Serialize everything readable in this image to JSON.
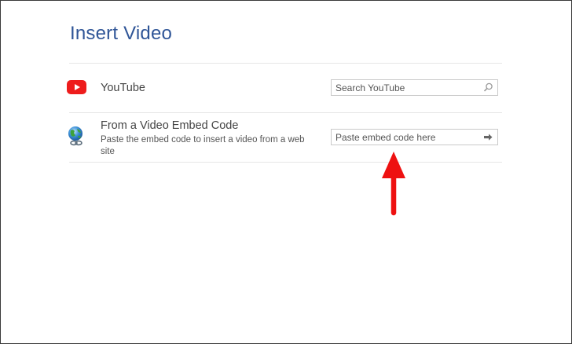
{
  "dialog": {
    "title": "Insert Video"
  },
  "youtube": {
    "label": "YouTube",
    "icon": "youtube-icon",
    "search": {
      "placeholder": "Search YouTube",
      "value": ""
    },
    "search_icon": "magnifier-icon"
  },
  "embed": {
    "label": "From a Video Embed Code",
    "description_line1": "Paste the embed code to insert a video from a web",
    "description_line2": "site",
    "icon": "globe-icon",
    "input": {
      "placeholder": "Paste embed code here",
      "value": ""
    },
    "submit_icon": "arrow-right-icon"
  },
  "colors": {
    "title": "#2f5597",
    "youtube_red": "#ee1c1c",
    "annotation_arrow": "#ee1111"
  }
}
